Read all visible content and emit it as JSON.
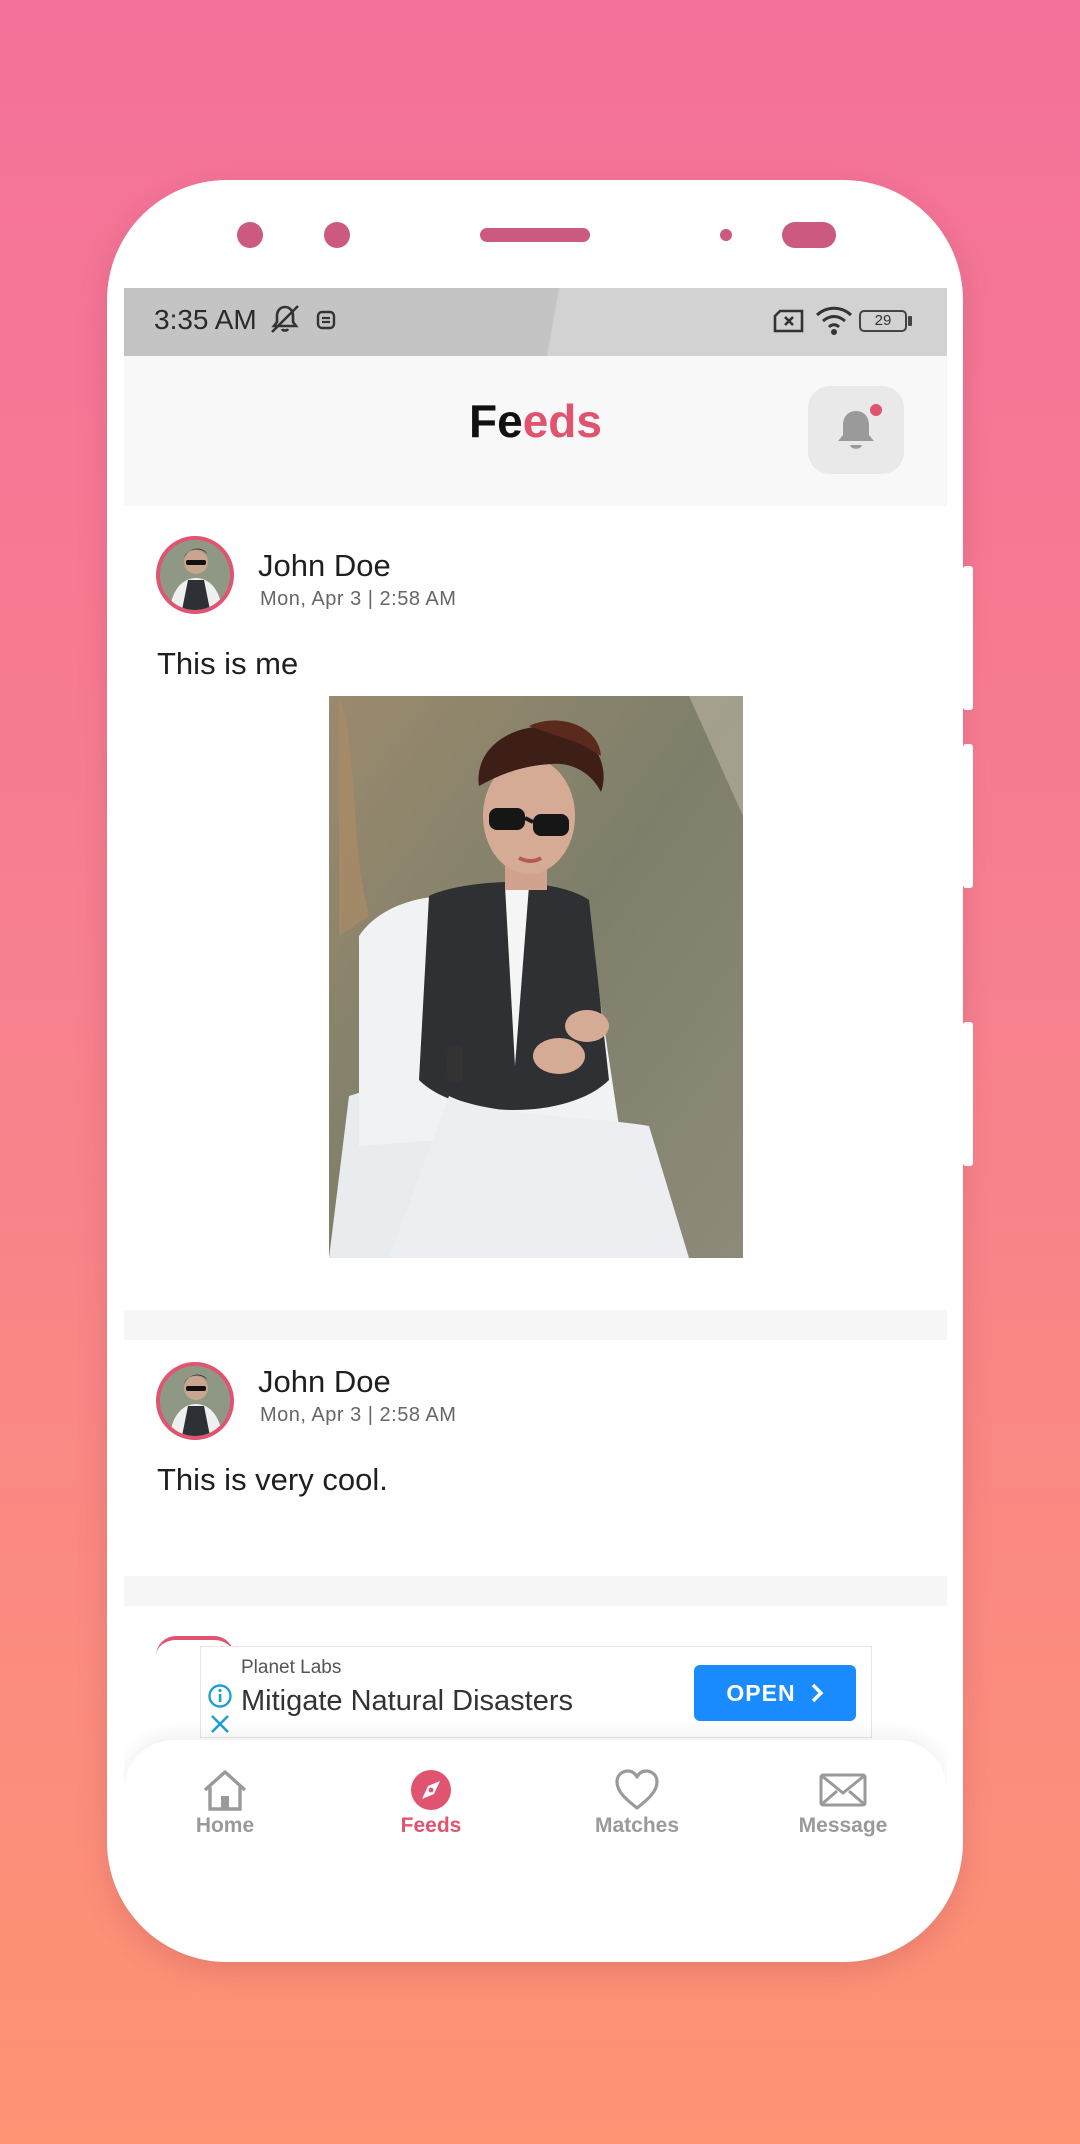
{
  "status_bar": {
    "time": "3:35 AM",
    "battery": "29"
  },
  "header": {
    "title_part1": "Fe",
    "title_part2": "eds"
  },
  "colors": {
    "accent": "#e0546f",
    "ad_button": "#1a8cff"
  },
  "posts": [
    {
      "author": "John Doe",
      "date": "Mon, Apr 3 | 2:58 AM",
      "caption": "This is me",
      "has_photo": true
    },
    {
      "author": "John Doe",
      "date": "Mon, Apr 3 | 2:58 AM",
      "caption": "This is very cool.",
      "has_photo": false
    }
  ],
  "ad": {
    "sponsor": "Planet Labs",
    "title": "Mitigate Natural Disasters",
    "button_label": "OPEN"
  },
  "nav": [
    {
      "label": "Home",
      "icon": "home-icon"
    },
    {
      "label": "Feeds",
      "icon": "compass-icon",
      "active": true
    },
    {
      "label": "Matches",
      "icon": "heart-icon"
    },
    {
      "label": "Message",
      "icon": "mail-icon"
    }
  ]
}
